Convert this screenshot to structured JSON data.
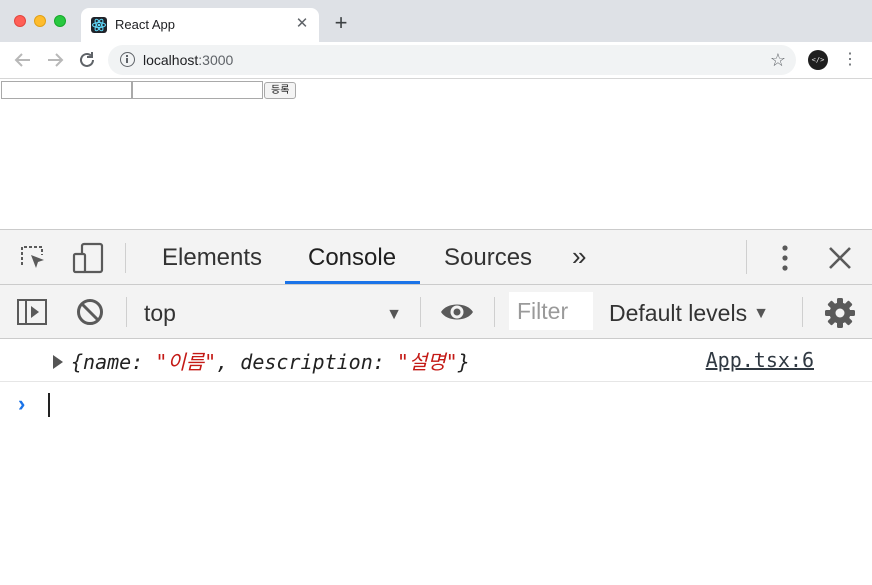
{
  "browser": {
    "tab_title": "React App",
    "tab_close": "✕",
    "new_tab": "+",
    "url_host": "localhost",
    "url_port": ":3000"
  },
  "page": {
    "register_button": "등록"
  },
  "devtools": {
    "tabs": [
      "Elements",
      "Console",
      "Sources"
    ],
    "active_tab": "Console",
    "context": "top",
    "filter_placeholder": "Filter",
    "levels_label": "Default levels",
    "console_message": {
      "open_brace": "{",
      "key1": "name",
      "val1": "\"이름\"",
      "key2": "description",
      "val2": "\"설명\"",
      "close_brace": "}",
      "source": "App.tsx:6"
    }
  }
}
